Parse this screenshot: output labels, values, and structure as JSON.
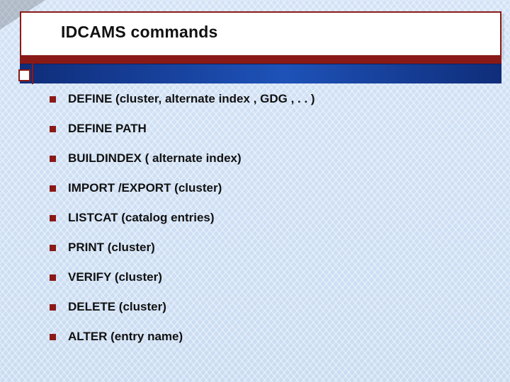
{
  "title": "IDCAMS commands",
  "items": [
    {
      "text": "DEFINE (cluster, alternate index , GDG , . . )"
    },
    {
      "text": "DEFINE PATH"
    },
    {
      "text": "BUILDINDEX ( alternate index)"
    },
    {
      "text": "IMPORT /EXPORT (cluster)"
    },
    {
      "text": "LISTCAT (catalog entries)"
    },
    {
      "text": "PRINT (cluster)"
    },
    {
      "text": "VERIFY (cluster)"
    },
    {
      "text": "DELETE (cluster)"
    },
    {
      "text": "ALTER (entry name)"
    }
  ]
}
